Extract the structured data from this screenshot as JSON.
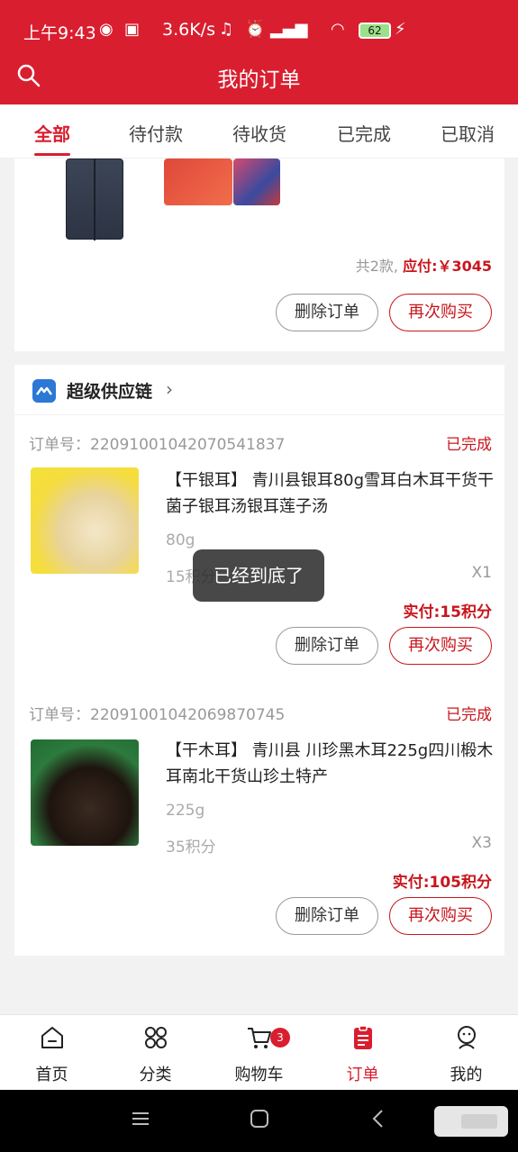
{
  "status_bar": {
    "time": "上午9:43",
    "network_speed": "3.6K/s",
    "battery": "62"
  },
  "header": {
    "title": "我的订单"
  },
  "tabs": [
    {
      "label": "全部",
      "active": true
    },
    {
      "label": "待付款",
      "active": false
    },
    {
      "label": "待收货",
      "active": false
    },
    {
      "label": "已完成",
      "active": false
    },
    {
      "label": "已取消",
      "active": false
    }
  ],
  "first_order": {
    "count_label": "共2款,",
    "payable_label": "应付:￥3045",
    "delete_btn": "删除订单",
    "rebuy_btn": "再次购买"
  },
  "shop": {
    "name": "超级供应链"
  },
  "orders": [
    {
      "order_no": "订单号：22091001042070541837",
      "status": "已完成",
      "name": "【干银耳】 青川县银耳80g雪耳白木耳干货干菌子银耳汤银耳莲子汤",
      "spec": "80g",
      "points": "15积分",
      "qty": "X1",
      "paid": "实付:15积分",
      "delete_btn": "删除订单",
      "rebuy_btn": "再次购买"
    },
    {
      "order_no": "订单号：22091001042069870745",
      "status": "已完成",
      "name": "【干木耳】 青川县 川珍黑木耳225g四川椴木耳南北干货山珍土特产",
      "spec": "225g",
      "points": "35积分",
      "qty": "X3",
      "paid": "实付:105积分",
      "delete_btn": "删除订单",
      "rebuy_btn": "再次购买"
    }
  ],
  "toast": "已经到底了",
  "bottom_nav": [
    {
      "label": "首页",
      "icon": "home-icon"
    },
    {
      "label": "分类",
      "icon": "category-icon"
    },
    {
      "label": "购物车",
      "icon": "cart-icon",
      "badge": "3"
    },
    {
      "label": "订单",
      "icon": "order-icon",
      "active": true
    },
    {
      "label": "我的",
      "icon": "profile-icon"
    }
  ],
  "colors": {
    "brand": "#d91e2f",
    "price": "#c8161d"
  }
}
